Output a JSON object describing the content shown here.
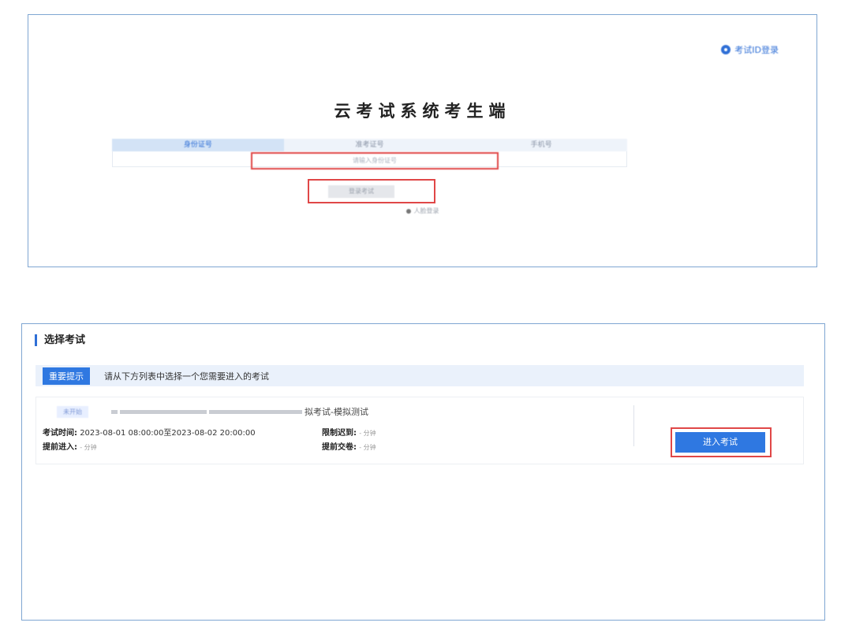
{
  "login": {
    "id_login_link": "考试ID登录",
    "title": "云考试系统考生端",
    "tabs": [
      "身份证号",
      "准考证号",
      "手机号"
    ],
    "id_placeholder": "请输入身份证号",
    "login_button": "登录考试",
    "face_login": "人脸登录"
  },
  "exam_select": {
    "section_title": "选择考试",
    "notice_tag": "重要提示",
    "notice_text": "请从下方列表中选择一个您需要进入的考试",
    "exam": {
      "status": "未开始",
      "name_suffix": "拟考试-模拟测试",
      "time_label": "考试时间:",
      "time_value": "2023-08-01 08:00:00至2023-08-02 20:00:00",
      "late_label": "限制迟到:",
      "late_value": "- 分钟",
      "early_enter_label": "提前进入:",
      "early_enter_value": "- 分钟",
      "early_submit_label": "提前交卷:",
      "early_submit_value": "- 分钟",
      "enter_button": "进入考试"
    }
  },
  "colors": {
    "accent": "#2f78e1",
    "highlight": "#e04747",
    "border": "#7fa6d2"
  }
}
